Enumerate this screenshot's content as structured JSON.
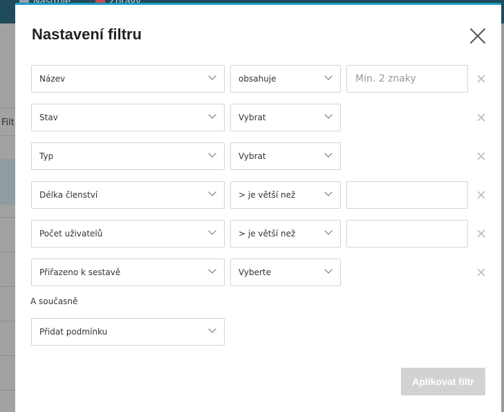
{
  "background": {
    "top_nav": [
      "Nástroje",
      "Zprávy"
    ],
    "left_text": "Filt"
  },
  "modal": {
    "title": "Nastavení filtru",
    "and_label": "A současně",
    "add_condition_label": "Přidat podmínku",
    "apply_label": "Aplikovat filtr",
    "rows": [
      {
        "field": "Název",
        "operator": "obsahuje",
        "has_input": true,
        "input_placeholder": "Min. 2 znaky",
        "input_value": ""
      },
      {
        "field": "Stav",
        "operator": "Vybrat",
        "has_input": false
      },
      {
        "field": "Typ",
        "operator": "Vybrat",
        "has_input": false
      },
      {
        "field": "Délka členství",
        "operator": "> je větší než",
        "has_input": true,
        "input_placeholder": "",
        "input_value": ""
      },
      {
        "field": "Počet uživatelů",
        "operator": "> je větší než",
        "has_input": true,
        "input_placeholder": "",
        "input_value": ""
      },
      {
        "field": "Přiřazeno k sestavě",
        "operator": "Vyberte",
        "has_input": false
      }
    ]
  },
  "colors": {
    "accent": "#1c9bc4",
    "apply_disabled": "#d2d2d2",
    "nav_background": "#1f4b5c"
  }
}
